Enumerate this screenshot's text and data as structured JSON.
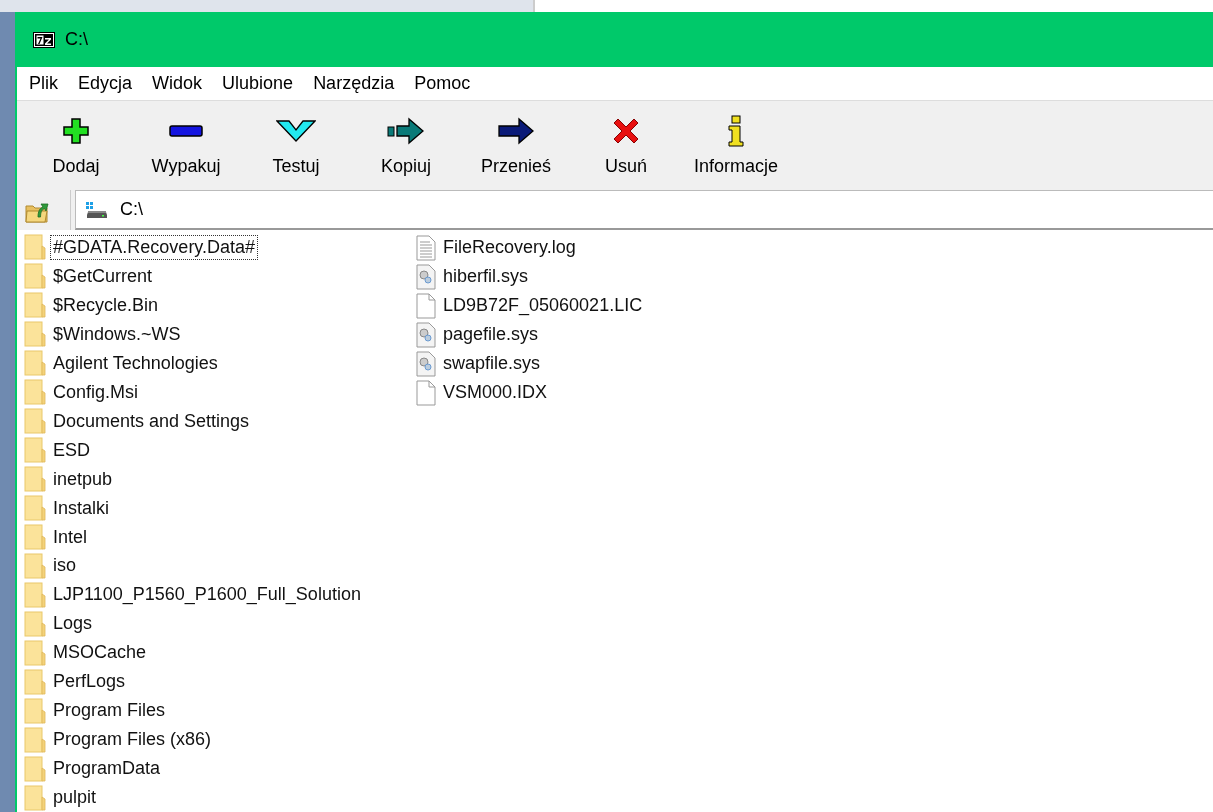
{
  "window": {
    "title": "C:\\"
  },
  "menu": [
    "Plik",
    "Edycja",
    "Widok",
    "Ulubione",
    "Narzędzia",
    "Pomoc"
  ],
  "toolbar": [
    {
      "label": "Dodaj",
      "kind": "add"
    },
    {
      "label": "Wypakuj",
      "kind": "extract"
    },
    {
      "label": "Testuj",
      "kind": "test"
    },
    {
      "label": "Kopiuj",
      "kind": "copy"
    },
    {
      "label": "Przenieś",
      "kind": "move"
    },
    {
      "label": "Usuń",
      "kind": "delete"
    },
    {
      "label": "Informacje",
      "kind": "info"
    }
  ],
  "address": {
    "value": "C:\\"
  },
  "file_list": {
    "columns": [
      [
        {
          "name": "#GDATA.Recovery.Data#",
          "kind": "folder",
          "focused": true
        },
        {
          "name": "$GetCurrent",
          "kind": "folder",
          "focused": false
        },
        {
          "name": "$Recycle.Bin",
          "kind": "folder",
          "focused": false
        },
        {
          "name": "$Windows.~WS",
          "kind": "folder",
          "focused": false
        },
        {
          "name": "Agilent Technologies",
          "kind": "folder",
          "focused": false
        },
        {
          "name": "Config.Msi",
          "kind": "folder",
          "focused": false
        },
        {
          "name": "Documents and Settings",
          "kind": "folder",
          "focused": false
        },
        {
          "name": "ESD",
          "kind": "folder",
          "focused": false
        },
        {
          "name": "inetpub",
          "kind": "folder",
          "focused": false
        },
        {
          "name": "Instalki",
          "kind": "folder",
          "focused": false
        },
        {
          "name": "Intel",
          "kind": "folder",
          "focused": false
        },
        {
          "name": "iso",
          "kind": "folder",
          "focused": false
        },
        {
          "name": "LJP1100_P1560_P1600_Full_Solution",
          "kind": "folder",
          "focused": false
        },
        {
          "name": "Logs",
          "kind": "folder",
          "focused": false
        },
        {
          "name": "MSOCache",
          "kind": "folder",
          "focused": false
        },
        {
          "name": "PerfLogs",
          "kind": "folder",
          "focused": false
        },
        {
          "name": "Program Files",
          "kind": "folder",
          "focused": false
        },
        {
          "name": "Program Files (x86)",
          "kind": "folder",
          "focused": false
        },
        {
          "name": "ProgramData",
          "kind": "folder",
          "focused": false
        },
        {
          "name": "pulpit",
          "kind": "folder",
          "focused": false
        }
      ],
      [
        {
          "name": "FileRecovery.log",
          "kind": "text",
          "focused": false
        },
        {
          "name": "hiberfil.sys",
          "kind": "system",
          "focused": false
        },
        {
          "name": "LD9B72F_05060021.LIC",
          "kind": "blank",
          "focused": false
        },
        {
          "name": "pagefile.sys",
          "kind": "system",
          "focused": false
        },
        {
          "name": "swapfile.sys",
          "kind": "system",
          "focused": false
        },
        {
          "name": "VSM000.IDX",
          "kind": "blank",
          "focused": false
        }
      ]
    ]
  }
}
